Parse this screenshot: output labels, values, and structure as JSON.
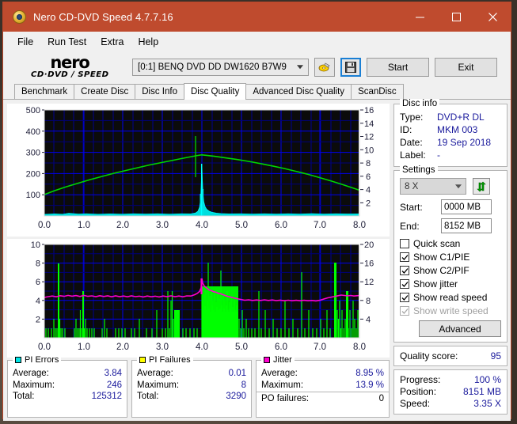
{
  "window": {
    "title": "Nero CD-DVD Speed 4.7.7.16",
    "icon": "nero-app-icon",
    "minimize": "–",
    "maximize": "□",
    "close": "✕",
    "titlebar_color": "#bf4b2e"
  },
  "menu": [
    "File",
    "Run Test",
    "Extra",
    "Help"
  ],
  "toolbar": {
    "logo_top": "nero",
    "logo_bottom": "CD·DVD ∕ SPEED",
    "drive": "[0:1]   BENQ DVD DD DW1620 B7W9",
    "eject_icon": "eject-disc-icon",
    "save_icon": "floppy-save-icon",
    "start_label": "Start",
    "exit_label": "Exit"
  },
  "tabs": [
    {
      "label": "Benchmark",
      "active": false
    },
    {
      "label": "Create Disc",
      "active": false
    },
    {
      "label": "Disc Info",
      "active": false
    },
    {
      "label": "Disc Quality",
      "active": true
    },
    {
      "label": "Advanced Disc Quality",
      "active": false
    },
    {
      "label": "ScanDisc",
      "active": false
    }
  ],
  "disc_info": {
    "legend": "Disc info",
    "rows": [
      {
        "key": "Type:",
        "value": "DVD+R DL"
      },
      {
        "key": "ID:",
        "value": "MKM 003"
      },
      {
        "key": "Date:",
        "value": "19 Sep 2018"
      },
      {
        "key": "Label:",
        "value": "-"
      }
    ]
  },
  "settings": {
    "legend": "Settings",
    "speed": "8 X",
    "refresh_icon": "refresh-icon",
    "start_label": "Start:",
    "start_value": "0000 MB",
    "end_label": "End:",
    "end_value": "8152 MB",
    "checks": [
      {
        "label": "Quick scan",
        "checked": false,
        "disabled": false
      },
      {
        "label": "Show C1/PIE",
        "checked": true,
        "disabled": false
      },
      {
        "label": "Show C2/PIF",
        "checked": true,
        "disabled": false
      },
      {
        "label": "Show jitter",
        "checked": true,
        "disabled": false
      },
      {
        "label": "Show read speed",
        "checked": true,
        "disabled": false
      },
      {
        "label": "Show write speed",
        "checked": true,
        "disabled": true
      }
    ],
    "advanced_label": "Advanced"
  },
  "quality": {
    "label": "Quality score:",
    "value": "95"
  },
  "progress": {
    "rows": [
      {
        "key": "Progress:",
        "value": "100 %"
      },
      {
        "key": "Position:",
        "value": "8151 MB"
      },
      {
        "key": "Speed:",
        "value": "3.35 X"
      }
    ]
  },
  "stats": {
    "pi_errors": {
      "legend": "PI Errors",
      "color": "#00e5e5",
      "rows": [
        {
          "key": "Average:",
          "value": "3.84"
        },
        {
          "key": "Maximum:",
          "value": "246"
        },
        {
          "key": "Total:",
          "value": "125312"
        }
      ]
    },
    "pi_failures": {
      "legend": "PI Failures",
      "color": "#ffff00",
      "rows": [
        {
          "key": "Average:",
          "value": "0.01"
        },
        {
          "key": "Maximum:",
          "value": "8"
        },
        {
          "key": "Total:",
          "value": "3290"
        }
      ]
    },
    "jitter": {
      "legend": "Jitter",
      "color": "#ff00d0",
      "rows": [
        {
          "key": "Average:",
          "value": "8.95 %"
        },
        {
          "key": "Maximum:",
          "value": "13.9 %"
        }
      ],
      "po_key": "PO failures:",
      "po_value": "0"
    }
  },
  "chart_data": [
    {
      "type": "line",
      "title": "PI Errors / read speed",
      "xlabel": "",
      "ylabel": "PI Errors",
      "x_ticks": [
        "0.0",
        "1.0",
        "2.0",
        "3.0",
        "4.0",
        "5.0",
        "6.0",
        "7.0",
        "8.0"
      ],
      "xlim": [
        0,
        8
      ],
      "left_ticks": [
        "100",
        "200",
        "300",
        "400",
        "500"
      ],
      "ylim": [
        0,
        500
      ],
      "right_ticks": [
        "2",
        "4",
        "6",
        "8",
        "10",
        "12",
        "14",
        "16"
      ],
      "ylim_right": [
        0,
        16
      ],
      "grid": true,
      "background": "#000000",
      "grid_color": "#0000cd",
      "series": [
        {
          "name": "read speed",
          "color": "#00d000",
          "type": "line",
          "x": [
            0.0,
            0.25,
            0.5,
            0.75,
            1.0,
            1.25,
            1.5,
            1.75,
            2.0,
            2.25,
            2.5,
            2.75,
            3.0,
            3.25,
            3.5,
            3.75,
            3.95,
            4.0,
            4.2,
            4.5,
            5.0,
            5.5,
            6.0,
            6.5,
            7.0,
            7.5,
            8.0
          ],
          "y": [
            3.2,
            3.5,
            3.85,
            4.2,
            4.5,
            4.8,
            5.1,
            5.4,
            5.7,
            6.0,
            6.3,
            6.6,
            6.9,
            7.2,
            7.5,
            7.75,
            7.95,
            7.95,
            7.85,
            7.6,
            7.0,
            6.4,
            5.8,
            5.1,
            4.5,
            3.9,
            3.3
          ]
        },
        {
          "name": "PI Errors",
          "color": "#00e5e5",
          "type": "area",
          "note": "Low baseline near 5-10 across disc with a tall narrow spike peaking ~246 at the 4.0 GB layer-break",
          "baseline": 5,
          "spike_x": 4.02,
          "spike_peak": 246
        }
      ]
    },
    {
      "type": "bar",
      "title": "PI Failures / jitter",
      "xlabel": "",
      "ylabel": "PI Failures",
      "x_ticks": [
        "0.0",
        "1.0",
        "2.0",
        "3.0",
        "4.0",
        "5.0",
        "6.0",
        "7.0",
        "8.0"
      ],
      "xlim": [
        0,
        8
      ],
      "left_ticks": [
        "2",
        "4",
        "6",
        "8",
        "10"
      ],
      "ylim": [
        0,
        10
      ],
      "right_ticks": [
        "4",
        "8",
        "12",
        "16",
        "20"
      ],
      "ylim_right": [
        0,
        20
      ],
      "grid": true,
      "background": "#000000",
      "grid_color": "#0000cd",
      "series": [
        {
          "name": "PI Failures",
          "color": "#00ff00",
          "type": "bar",
          "note": "Sparse 1-unit spikes before 4.0 GB (max 8 near 0.25), dense cluster of 2-8 from 4.0 to 5.0, scattered after, max 8 near 7.45",
          "max": 8
        },
        {
          "name": "jitter",
          "color": "#ff00d0",
          "type": "line",
          "note": "Jitter % on right axis; ~8.9 before layer break, peak 13.9 at 4.0, settles ~8.3-9.2 after",
          "average": 8.95,
          "maximum": 13.9
        }
      ]
    }
  ]
}
